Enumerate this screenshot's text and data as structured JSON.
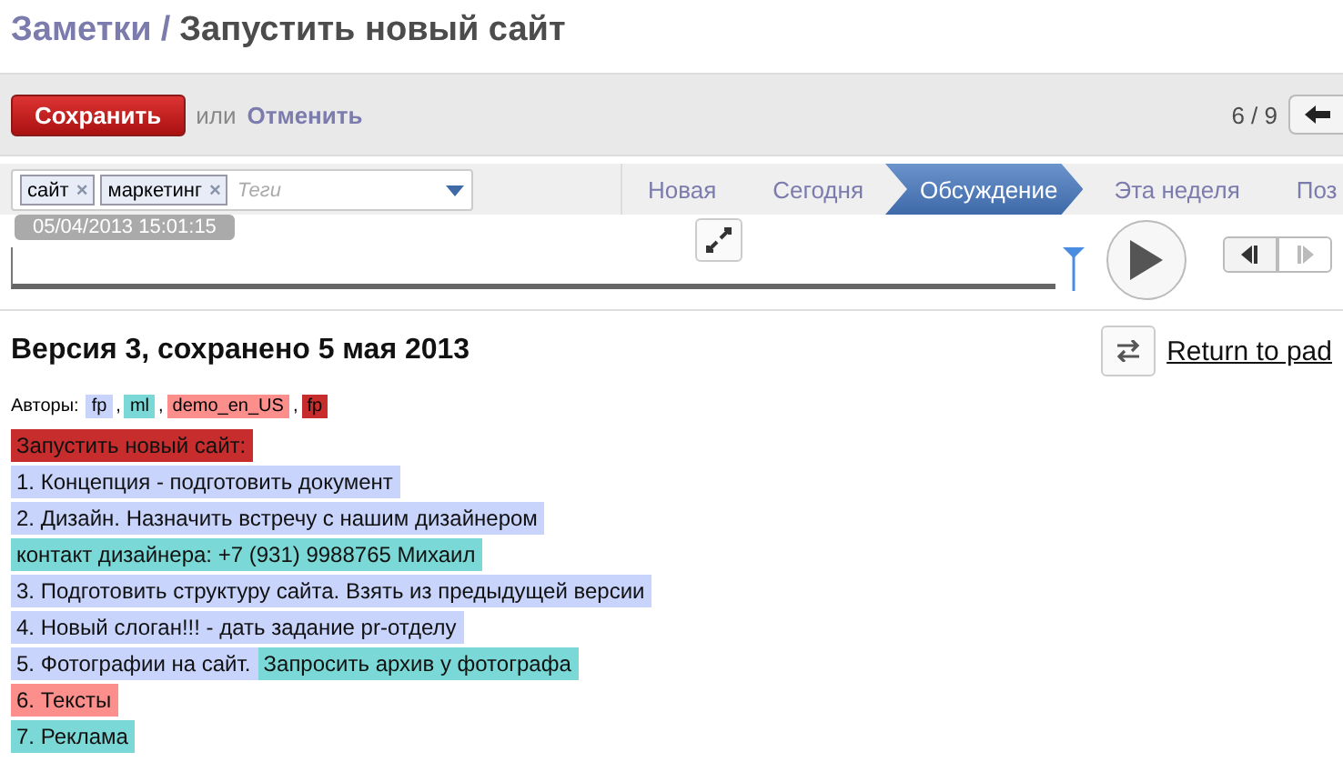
{
  "breadcrumb": {
    "parent": "Заметки",
    "separator": "/",
    "current": "Запустить новый сайт"
  },
  "toolbar": {
    "save": "Сохранить",
    "or": "или",
    "cancel": "Отменить",
    "pager": "6 / 9"
  },
  "tags": {
    "items": [
      "сайт",
      "маркетинг"
    ],
    "remove": "×",
    "placeholder": "Теги"
  },
  "stages": [
    {
      "label": "Новая",
      "selected": false
    },
    {
      "label": "Сегодня",
      "selected": false
    },
    {
      "label": "Обсуждение",
      "selected": true
    },
    {
      "label": "Эта неделя",
      "selected": false
    },
    {
      "label": "Поз",
      "selected": false
    }
  ],
  "timeslider": {
    "date": "05/04/2013 15:01:15",
    "level": 1
  },
  "version": {
    "title": "Версия 3, сохранено 5 мая 2013",
    "return_link": "Return to pad",
    "authors_label": "Авторы:",
    "authors_separator": ",",
    "authors": [
      {
        "name": "fp",
        "color": "#c8d4fc"
      },
      {
        "name": "ml",
        "color": "#7ad9d6"
      },
      {
        "name": "demo_en_US",
        "color": "#fc8f8b"
      },
      {
        "name": "fp",
        "color": "#c72d2d"
      }
    ],
    "lines": [
      [
        {
          "text": "Запустить новый сайт:",
          "color": "#c72d2d"
        }
      ],
      [
        {
          "text": "1. Концепция - подготовить документ",
          "color": "#c8d4fc"
        }
      ],
      [
        {
          "text": "2. Дизайн. Назначить встречу с нашим дизайнером",
          "color": "#c8d4fc"
        }
      ],
      [
        {
          "text": "контакт дизайнера: +7 (931) 9988765 Михаил",
          "color": "#7ad9d6"
        }
      ],
      [
        {
          "text": "3. Подготовить структуру сайта. Взять из предыдущей версии",
          "color": "#c8d4fc"
        }
      ],
      [
        {
          "text": "4. Новый слоган!!! - дать задание pr-отделу",
          "color": "#c8d4fc"
        }
      ],
      [
        {
          "text": "5. Фотографии на сайт.",
          "color": "#c8d4fc"
        },
        {
          "text": "Запросить архив у фотографа",
          "color": "#7ad9d6"
        }
      ],
      [
        {
          "text": "6. Тексты",
          "color": "#fc8f8b"
        }
      ],
      [
        {
          "text": "7. Реклама",
          "color": "#7ad9d6"
        }
      ]
    ]
  }
}
